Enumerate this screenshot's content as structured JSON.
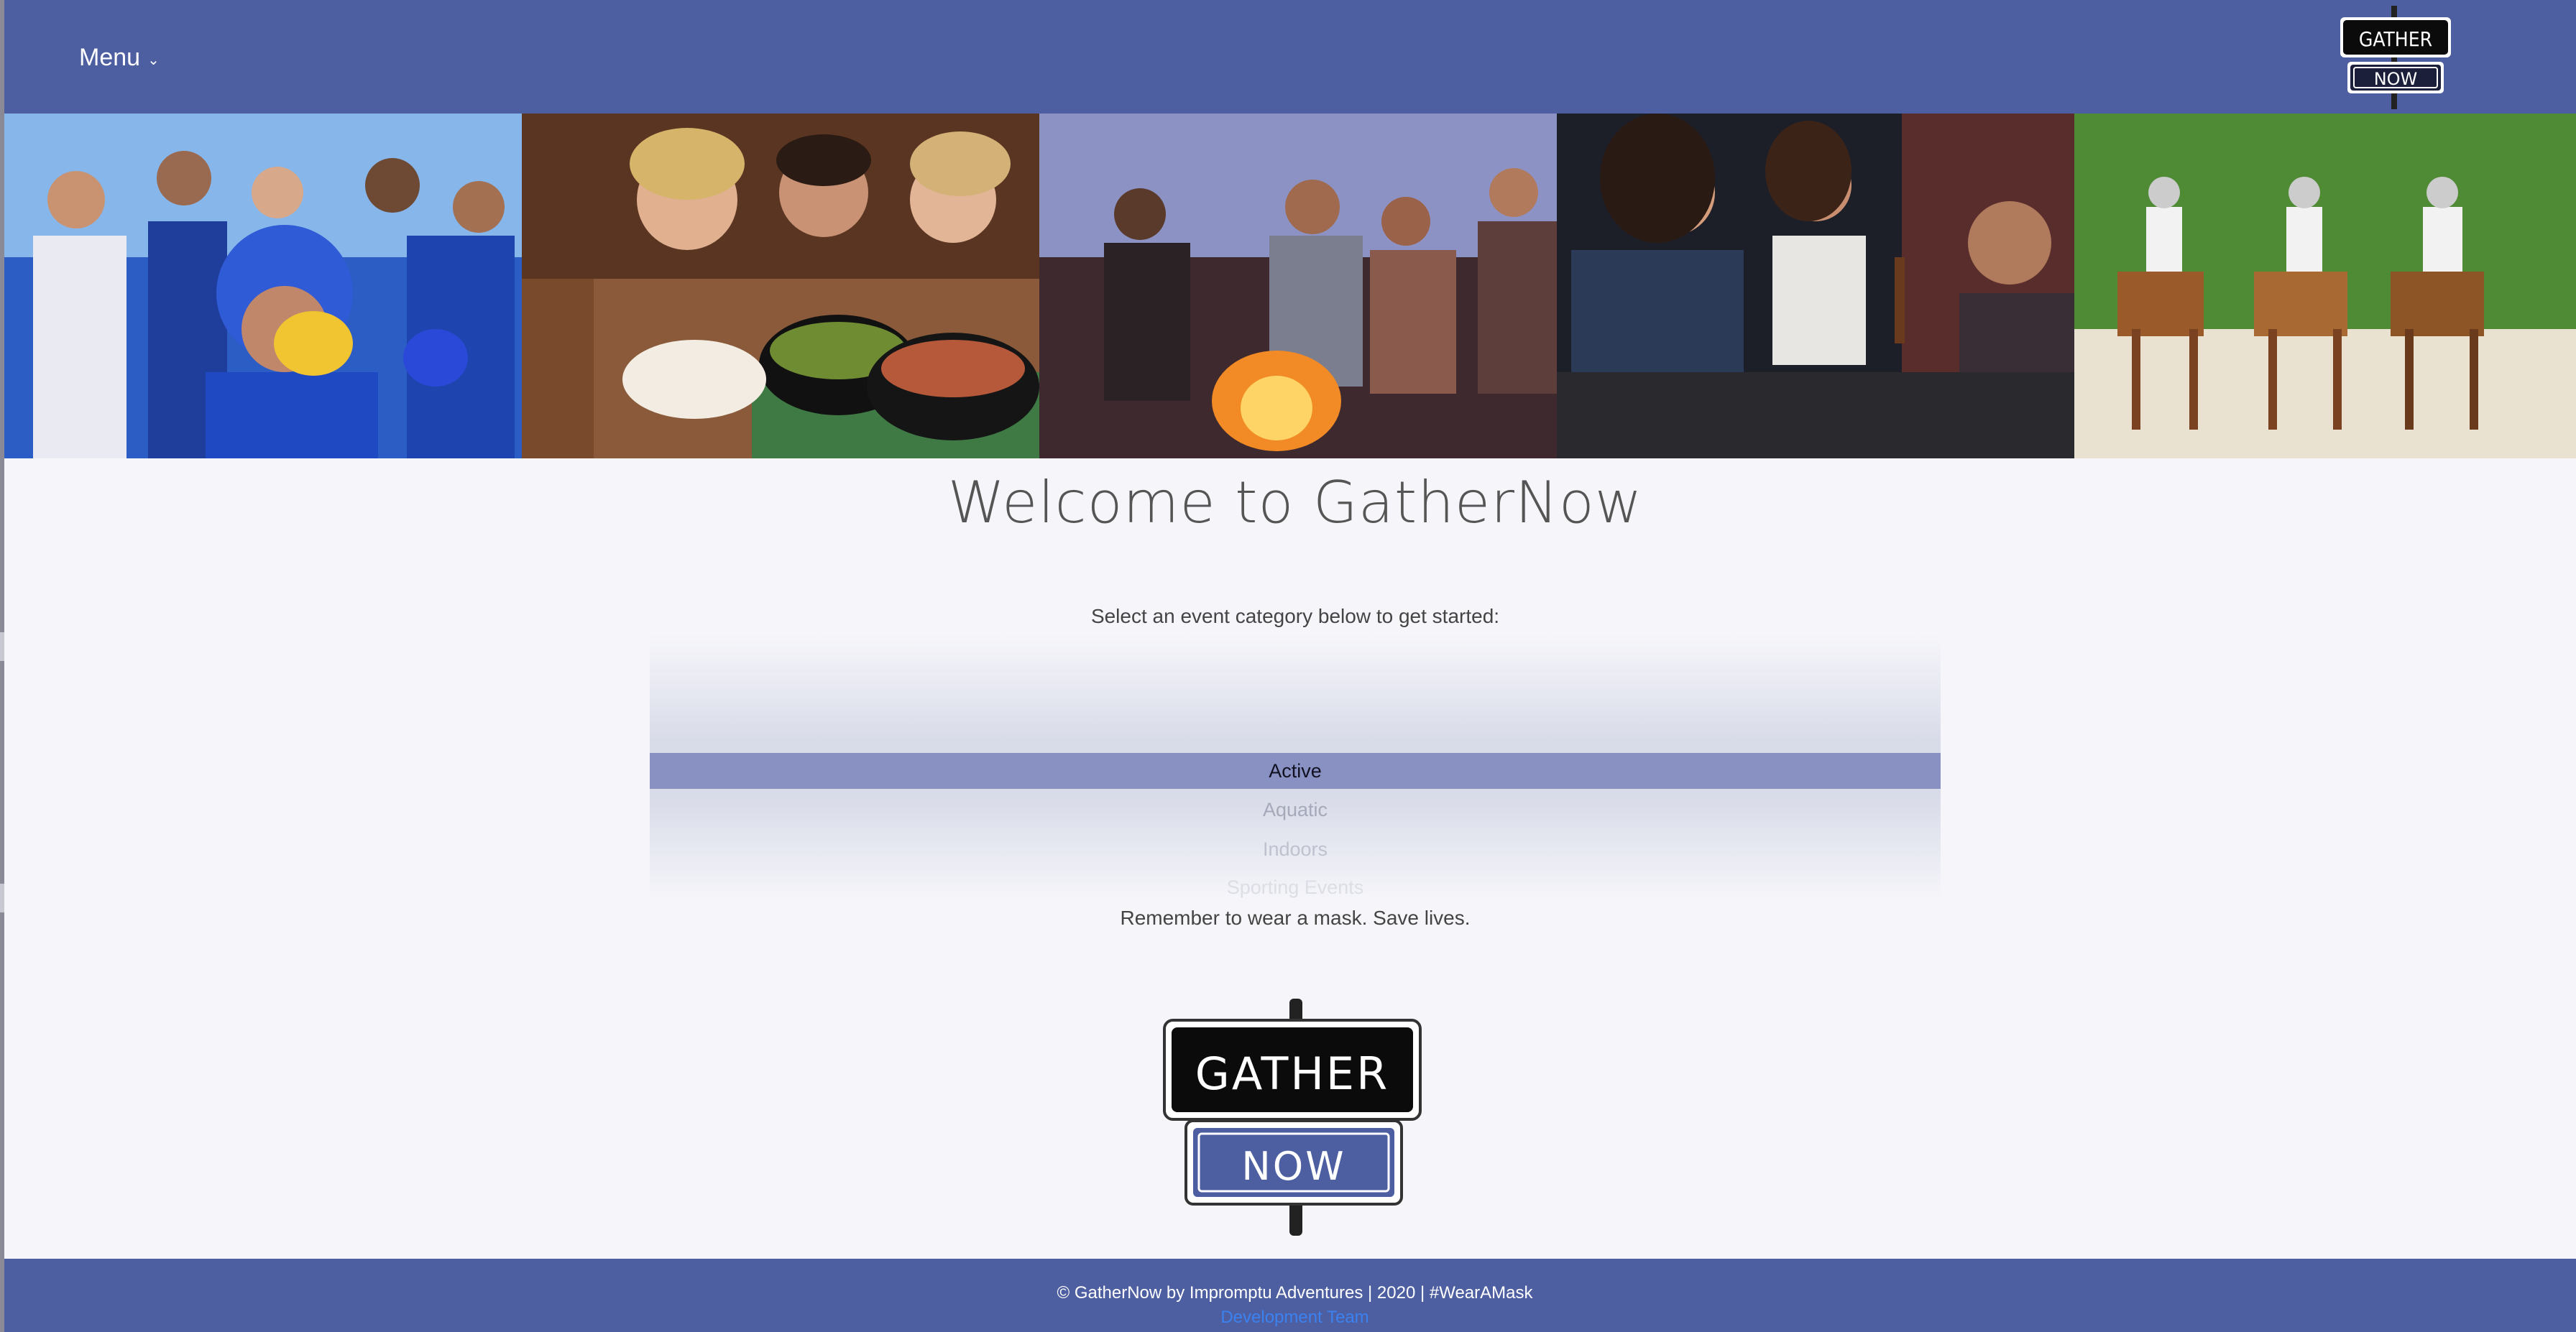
{
  "header": {
    "menu_label": "Menu",
    "menu_icon": "chevron-down-icon",
    "logo_top": "GATHER",
    "logo_bottom": "NOW"
  },
  "banner": {
    "photos": [
      "sports-fans-cheering",
      "friends-dining-noodles",
      "beach-campfire-smores",
      "friends-toasting-drinks",
      "horseback-riders"
    ]
  },
  "main": {
    "title": "Welcome to GatherNow",
    "subtitle": "Select an event category below to get started:",
    "categories": [
      "Active",
      "Aquatic",
      "Indoors",
      "Sporting Events"
    ],
    "selected_category": "Active",
    "reminder": "Remember to wear a mask. Save lives.",
    "logo_top": "GATHER",
    "logo_bottom": "NOW"
  },
  "footer": {
    "copyright": "© GatherNow by Impromptu Adventures | 2020 | #WearAMask",
    "team_link": "Development Team"
  },
  "colors": {
    "header_bg": "#4d5ea1",
    "page_bg": "#f5f5fa",
    "selected_option_bg": "#8891c2",
    "link": "#3b82f0"
  }
}
